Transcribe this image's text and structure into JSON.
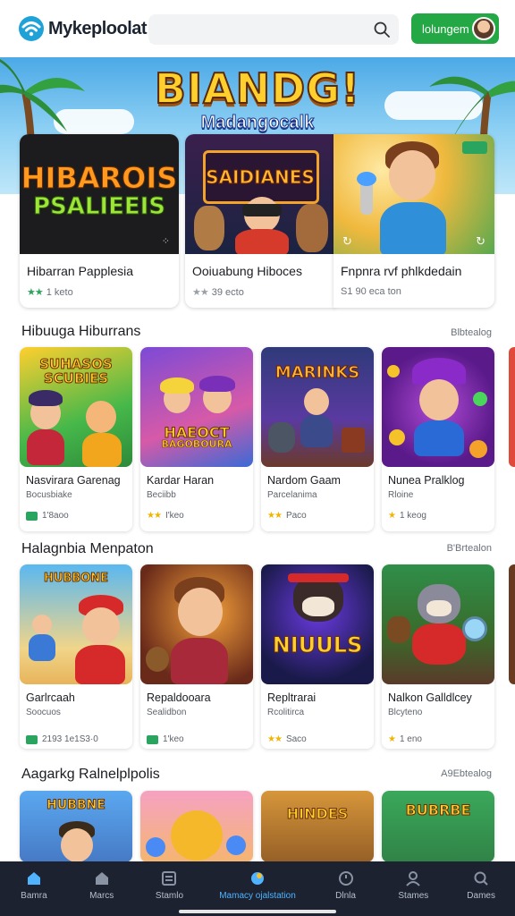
{
  "header": {
    "app_name": "Mykeploolat",
    "search_placeholder": "",
    "login_label": "lolungem",
    "colors": {
      "accent_green": "#24a845"
    }
  },
  "hero": {
    "title": "BIANDG!",
    "subtitle": "Madangocalk"
  },
  "featured": [
    {
      "art_title": "HIBAROIS",
      "art_sub": "PSALIEEIS",
      "title": "Hibarran Papplesia",
      "meta": "1 keto",
      "stars": "★★"
    },
    {
      "art_title": "SAIDIANES",
      "title": "Ooiuabung Hiboces",
      "meta": "39 ecto",
      "stars": "★★"
    },
    {
      "title": "Fnpnra rvf phlkdedain",
      "meta": "S1 90 eca ton",
      "stars": ""
    }
  ],
  "sections": [
    {
      "title": "Hibuuga Hiburrans",
      "link": "Blbtealog",
      "cards": [
        {
          "art_title": "SUHASOS",
          "art_sub": "SCUBIES",
          "title": "Nasvirara Garenag",
          "sub": "Bocusbiake",
          "meta": "1'8aoo",
          "rating": "badge"
        },
        {
          "art_title": "HAEOCT",
          "art_sub": "BAGOBOURA",
          "title": "Kardar Haran",
          "sub": "Beciibb",
          "meta": "I'keo",
          "rating": "stars"
        },
        {
          "art_title": "MARINKS",
          "title": "Nardom Gaam",
          "sub": "Parcelanima",
          "meta": "Paco",
          "rating": "stars"
        },
        {
          "title": "Nunea Pralklog",
          "sub": "Rloine",
          "meta": "1 keog",
          "rating": "stars"
        }
      ]
    },
    {
      "title": "Halagnbia Menpaton",
      "link": "B'Brtealon",
      "cards": [
        {
          "art_title": "HUBBONE",
          "title": "Garlrcaah",
          "sub": "Soocuos",
          "meta": "2193 1e1S3·0",
          "rating": "badge"
        },
        {
          "title": "Repaldooara",
          "sub": "Sealidbon",
          "meta": "1'keo",
          "rating": "badge"
        },
        {
          "art_title": "NIUULS",
          "title": "Repltrarai",
          "sub": "Rcolitirca",
          "meta": "Saco",
          "rating": "stars"
        },
        {
          "title": "Nalkon Galldlcey",
          "sub": "Blcyteno",
          "meta": "1 eno",
          "rating": "stars"
        }
      ]
    },
    {
      "title": "Aagarkg Ralnelplpolis",
      "link": "A9Ebtealog",
      "cards": [
        {
          "art_title": "HUBBNE",
          "rating": "none"
        },
        {
          "rating": "none"
        },
        {
          "art_title": "HINDES",
          "rating": "none"
        },
        {
          "art_title": "BUBRBE",
          "rating": "none"
        }
      ]
    }
  ],
  "bottom_nav": [
    {
      "label": "Bamra",
      "icon": "home-icon",
      "active": false
    },
    {
      "label": "Marcs",
      "icon": "house-icon",
      "active": false
    },
    {
      "label": "Stamlo",
      "icon": "list-icon",
      "active": false
    },
    {
      "label": "Mamacy ojalstation",
      "icon": "station-icon",
      "active": true
    },
    {
      "label": "Dlnla",
      "icon": "clock-icon",
      "active": false
    },
    {
      "label": "Stames",
      "icon": "user-icon",
      "active": false
    },
    {
      "label": "Dames",
      "icon": "search-icon",
      "active": false
    }
  ]
}
